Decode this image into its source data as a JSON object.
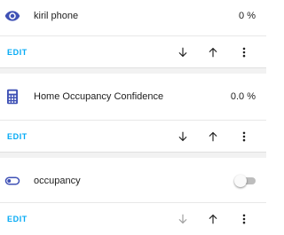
{
  "entities": [
    {
      "icon": "eye-icon",
      "name": "kiril phone",
      "value": "0 %",
      "control": "text"
    },
    {
      "icon": "calculator-icon",
      "name": "Home Occupancy Confidence",
      "value": "0.0 %",
      "control": "text"
    },
    {
      "icon": "toggle-switch-icon",
      "name": "occupancy",
      "value": "off",
      "control": "toggle"
    }
  ],
  "actions": {
    "edit_label": "EDIT",
    "move_down_icon": "arrow-down-icon",
    "move_up_icon": "arrow-up-icon",
    "more_icon": "more-vertical-icon"
  },
  "colors": {
    "accent": "#03a9f4",
    "icon": "#3f51b5",
    "action_icon": "#212121",
    "disabled_icon": "#9e9e9e"
  }
}
